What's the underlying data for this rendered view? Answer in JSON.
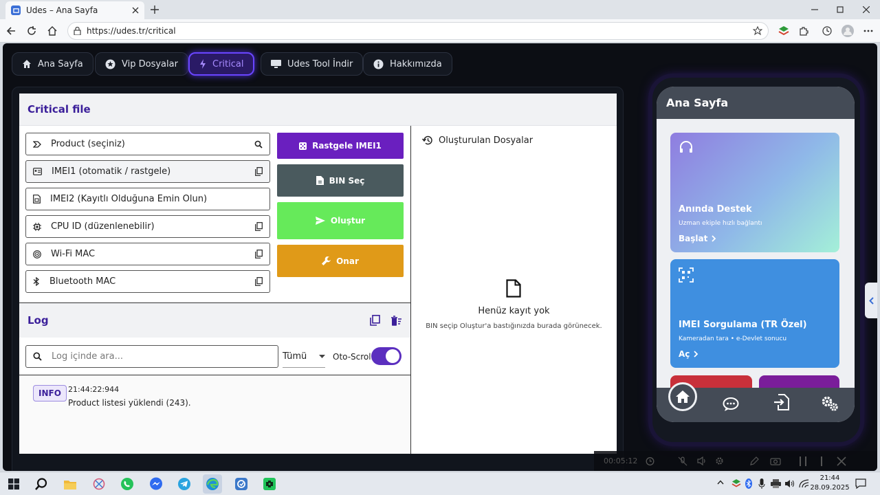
{
  "browser": {
    "tab_title": "Udes – Ana Sayfa",
    "url": "https://udes.tr/critical"
  },
  "nav": [
    {
      "label": "Ana Sayfa",
      "icon": "home-icon"
    },
    {
      "label": "Vip Dosyalar",
      "icon": "star-icon"
    },
    {
      "label": "Critical",
      "icon": "bolt-icon",
      "active": true
    },
    {
      "label": "Udes Tool İndir",
      "icon": "monitor-icon"
    },
    {
      "label": "Hakkımızda",
      "icon": "info-icon"
    }
  ],
  "critical": {
    "title": "Critical file",
    "fields": [
      {
        "label": "Product (seçiniz)",
        "icon": "label-icon",
        "action": "search-icon"
      },
      {
        "label": "IMEI1 (otomatik / rastgele)",
        "icon": "card-icon",
        "action": "copy-icon"
      },
      {
        "label": "IMEI2 (Kayıtlı Olduğuna Emin Olun)",
        "icon": "sim-icon",
        "action": ""
      },
      {
        "label": "CPU ID (düzenlenebilir)",
        "icon": "chip-icon",
        "action": "copy-icon"
      },
      {
        "label": "Wi-Fi MAC",
        "icon": "wifi-icon",
        "action": "copy-icon"
      },
      {
        "label": "Bluetooth MAC",
        "icon": "bluetooth-icon",
        "action": "copy-icon"
      }
    ],
    "actions": [
      {
        "label": "Rastgele IMEI1",
        "color": "#6a1fbf",
        "icon": "dice-icon"
      },
      {
        "label": "BIN Seç",
        "color": "#4a5a5e",
        "icon": "file-icon"
      },
      {
        "label": "Oluştur",
        "color": "#66ea5a",
        "icon": "send-icon"
      },
      {
        "label": "Onar",
        "color": "#e09a18",
        "icon": "wrench-icon"
      }
    ],
    "files": {
      "title": "Oluşturulan Dosyalar",
      "empty_title": "Henüz kayıt yok",
      "empty_hint": "BIN seçip Oluştur'a bastığınızda burada görünecek."
    }
  },
  "log": {
    "title": "Log",
    "search_placeholder": "Log içinde ara...",
    "filter": "Tümü",
    "auto_scroll": "Oto-Scroll",
    "auto_scroll_on": true,
    "entries": [
      {
        "level": "INFO",
        "time": "21:44:22:944",
        "message": "Product listesi yüklendi (243)."
      }
    ]
  },
  "phone": {
    "title": "Ana Sayfa",
    "cards": [
      {
        "title": "Anında Destek",
        "subtitle": "Uzman ekiple hızlı bağlantı",
        "action": "Başlat"
      },
      {
        "title": "IMEI Sorgulama (TR Özel)",
        "subtitle": "Kameradan tara • e-Devlet sonucu",
        "action": "Aç"
      }
    ]
  },
  "video": {
    "time": "00:05:12"
  },
  "taskbar": {
    "time": "21:44",
    "date": "28.09.2025"
  },
  "colors": {
    "accent": "#3b1f9a",
    "active_nav": "#6a45ff",
    "page_bg": "#0c0e14"
  }
}
